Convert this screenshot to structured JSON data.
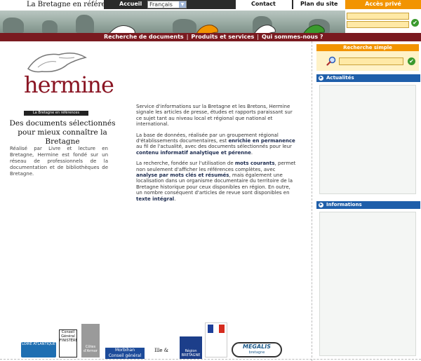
{
  "header": {
    "brand_title": "La Bretagne en références",
    "nav": {
      "home": "Accueil",
      "language_selected": "Français",
      "contact": "Contact",
      "sitemap": "Plan du site",
      "private_access": "Accès privé"
    }
  },
  "menu": {
    "items": [
      "Recherche de documents",
      "Produits et services",
      "Qui sommes-nous ?"
    ],
    "separator": "|"
  },
  "logo": {
    "word": "hermine",
    "subtitle": "La Bretagne en références"
  },
  "left": {
    "tagline_line1": "Des documents sélectionnés",
    "tagline_line2": "pour mieux connaître la Bretagne",
    "text": "Réalisé par Livre et lecture en Bretagne, Hermine est fondé sur un réseau de professionnels de la documentation et de bibliothèques de Bretagne."
  },
  "center": {
    "p1": "Service d'informations sur la Bretagne et les Bretons, Hermine signale les articles de presse, études et rapports paraissant sur ce sujet tant au niveau local et régional que national et international.",
    "p2_a": "La base de données, réalisée par un groupement régional d'établissements documentaires, est ",
    "p2_b": "enrichie en permanence",
    "p2_c": " au fil de l'actualité, avec des documents sélectionnés pour leur ",
    "p2_d": "contenu informatif analytique et pérenne",
    "p2_e": ".",
    "p3_a": "La recherche, fondée sur l'utilisation de ",
    "p3_b": "mots courants",
    "p3_c": ", permet non seulement d'afficher les références complètes, avec ",
    "p3_d": "analyse par mots clés et résumés",
    "p3_e": ", mais également une localisation dans un organisme documentaire du territoire de la Bretagne historique pour ceux disponibles en région. En outre, un nombre conséquent d'articles de revue sont disponibles en ",
    "p3_f": "texte intégral",
    "p3_g": "."
  },
  "right": {
    "search_title": "Recherche simple",
    "news_title": "Actualités",
    "info_title": "Informations"
  },
  "partners": {
    "loire": "LOIRE ATLANTIQUE",
    "finistere": "Conseil Général FINISTÈRE",
    "cotes": "Côtes d'Armor",
    "morbihan": "Morbihan",
    "morbihan_sub": "Conseil général",
    "ille": "Ille & Vilaine",
    "bretagne_region": "Région BRETAGNE",
    "megalis": "MEGALIS",
    "megalis_sub": "bretagne"
  },
  "colors": {
    "menubar": "#7a1a20",
    "private_orange": "#f29400",
    "panel_blue": "#1f5faa",
    "logo_red": "#8a1523"
  }
}
